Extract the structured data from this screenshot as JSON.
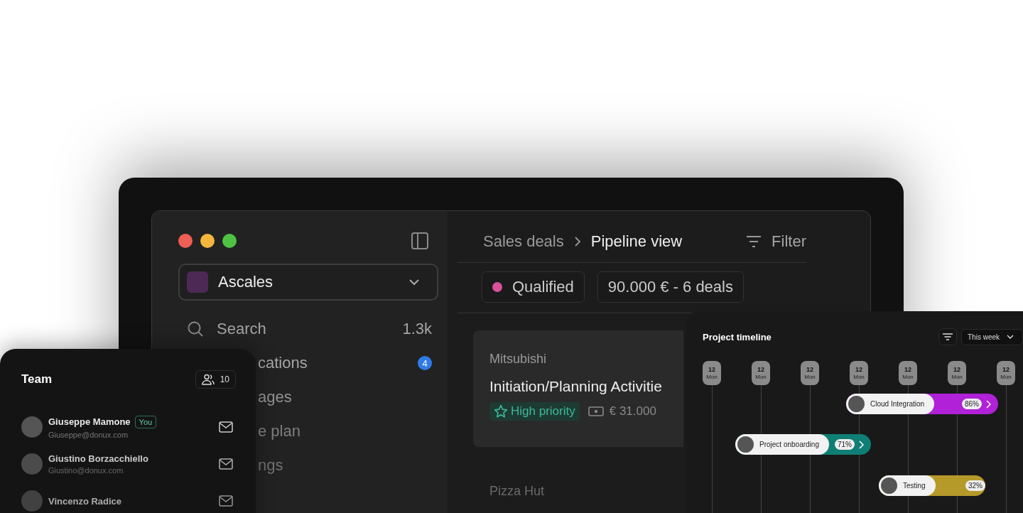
{
  "sidebar": {
    "workspace": "Ascales",
    "search": {
      "label": "Search",
      "count": "1.3k"
    },
    "items": [
      {
        "label": "cations",
        "badge": "4"
      },
      {
        "label": "ages"
      },
      {
        "label": "e plan"
      },
      {
        "label": "ngs"
      }
    ]
  },
  "breadcrumb": [
    "Sales deals",
    "Pipeline view"
  ],
  "filter": "Filter",
  "stage": {
    "name": "Qualified",
    "color": "#d9509e",
    "summary": "90.000 € - 6 deals"
  },
  "deals": [
    {
      "company": "Mitsubishi",
      "title": "Initiation/Planning Activitie",
      "tag": "High priority",
      "amount": "€ 31.000"
    },
    {
      "company": "Pizza Hut"
    }
  ],
  "team": {
    "title": "Team",
    "member_count": "10",
    "members": [
      {
        "name": "Giuseppe Mamone",
        "badge": "You",
        "email": "Giuseppe@donux.com"
      },
      {
        "name": "Giustino Borzacchiello",
        "email": "Giustino@donux.com"
      },
      {
        "name": "Vincenzo Radice"
      }
    ]
  },
  "timeline": {
    "title": "Project timeline",
    "range": "This week",
    "days": [
      {
        "date": "12",
        "weekday": "Mon"
      },
      {
        "date": "12",
        "weekday": "Mon"
      },
      {
        "date": "12",
        "weekday": "Mon"
      },
      {
        "date": "12",
        "weekday": "Mon"
      },
      {
        "date": "12",
        "weekday": "Mon"
      },
      {
        "date": "12",
        "weekday": "Mon"
      },
      {
        "date": "12",
        "weekday": "Mon"
      }
    ],
    "tasks": [
      {
        "name": "Cloud Integration",
        "percent": "86%",
        "color": "#b021d8",
        "arrow": true
      },
      {
        "name": "Project onboarding",
        "percent": "71%",
        "color": "#0f7f75",
        "arrow": true
      },
      {
        "name": "Testing",
        "percent": "32%",
        "color": "#b59a2a",
        "arrow": false
      }
    ]
  }
}
